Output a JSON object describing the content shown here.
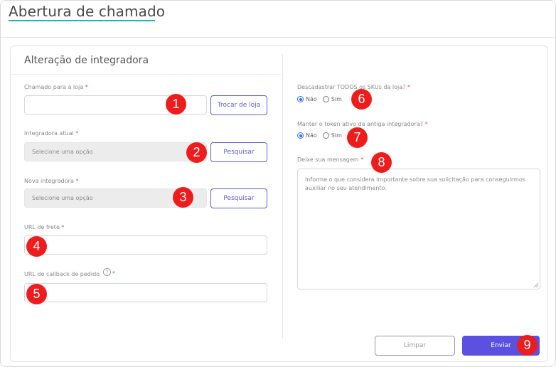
{
  "header": {
    "title": "Abertura de chamado"
  },
  "form": {
    "section_title": "Alteração de integradora",
    "store": {
      "label": "Chamado para a loja",
      "required": "*",
      "value": "",
      "button": "Trocar de loja"
    },
    "current_integrator": {
      "label": "Integradora atual",
      "required": "*",
      "placeholder": "Selecione uma opção",
      "button": "Pesquisar"
    },
    "new_integrator": {
      "label": "Nova integradora",
      "required": "*",
      "placeholder": "Selecione uma opção",
      "button": "Pesquisar"
    },
    "shipping_url": {
      "label": "URL de frete",
      "required": "*",
      "value": ""
    },
    "callback_url": {
      "label": "URL de callback de pedido",
      "required": "*",
      "help": "?",
      "value": ""
    },
    "unregister_skus": {
      "label": "Descadastrar TODOS os SKUs da loja?",
      "required": "*",
      "options": [
        "Não",
        "Sim"
      ],
      "selected": "Não"
    },
    "keep_token": {
      "label": "Manter o token ativo da antiga integradora?",
      "required": "*",
      "options": [
        "Não",
        "Sim"
      ],
      "selected": "Não"
    },
    "message": {
      "label": "Deixe sua mensagem",
      "required": "*",
      "placeholder": "Informe o que considera importante sobre sua solicitação para conseguirmos auxiliar no seu atendimento."
    },
    "actions": {
      "clear": "Limpar",
      "send": "Enviar"
    }
  },
  "markers": [
    "1",
    "2",
    "3",
    "4",
    "5",
    "6",
    "7",
    "8",
    "9"
  ],
  "colors": {
    "accent": "#5b50e0",
    "underline": "#22b5b0",
    "radio_selected": "#2f6fe0",
    "marker": "#ee1c1c",
    "required": "#e05050"
  }
}
